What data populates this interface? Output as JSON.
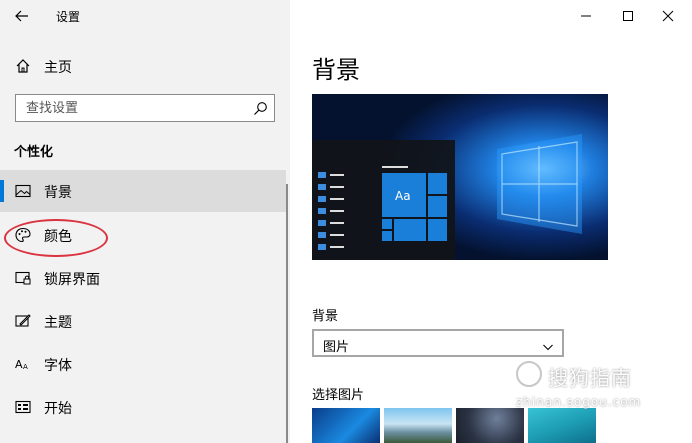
{
  "window": {
    "title": "设置"
  },
  "sidebar": {
    "home_label": "主页",
    "search": {
      "placeholder": "查找设置",
      "value": ""
    },
    "section_title": "个性化",
    "items": [
      {
        "label": "背景",
        "icon": "image-icon",
        "active": true
      },
      {
        "label": "颜色",
        "icon": "palette-icon",
        "active": false
      },
      {
        "label": "锁屏界面",
        "icon": "lock-screen-icon",
        "active": false
      },
      {
        "label": "主题",
        "icon": "theme-icon",
        "active": false
      },
      {
        "label": "字体",
        "icon": "font-icon",
        "active": false
      },
      {
        "label": "开始",
        "icon": "start-icon",
        "active": false
      }
    ]
  },
  "main": {
    "title": "背景",
    "background_label": "背景",
    "background_value": "图片",
    "choose_picture_label": "选择图片",
    "preview_tile_label": "Aa"
  },
  "watermark": {
    "text": "搜狗指南",
    "subtext": "zhinan.sogou.com"
  },
  "colors": {
    "accent": "#0078d7",
    "sidebar_bg": "#f2f2f2",
    "active_item_bg": "#dcdcdc",
    "annotation_ellipse": "#d9343f"
  }
}
